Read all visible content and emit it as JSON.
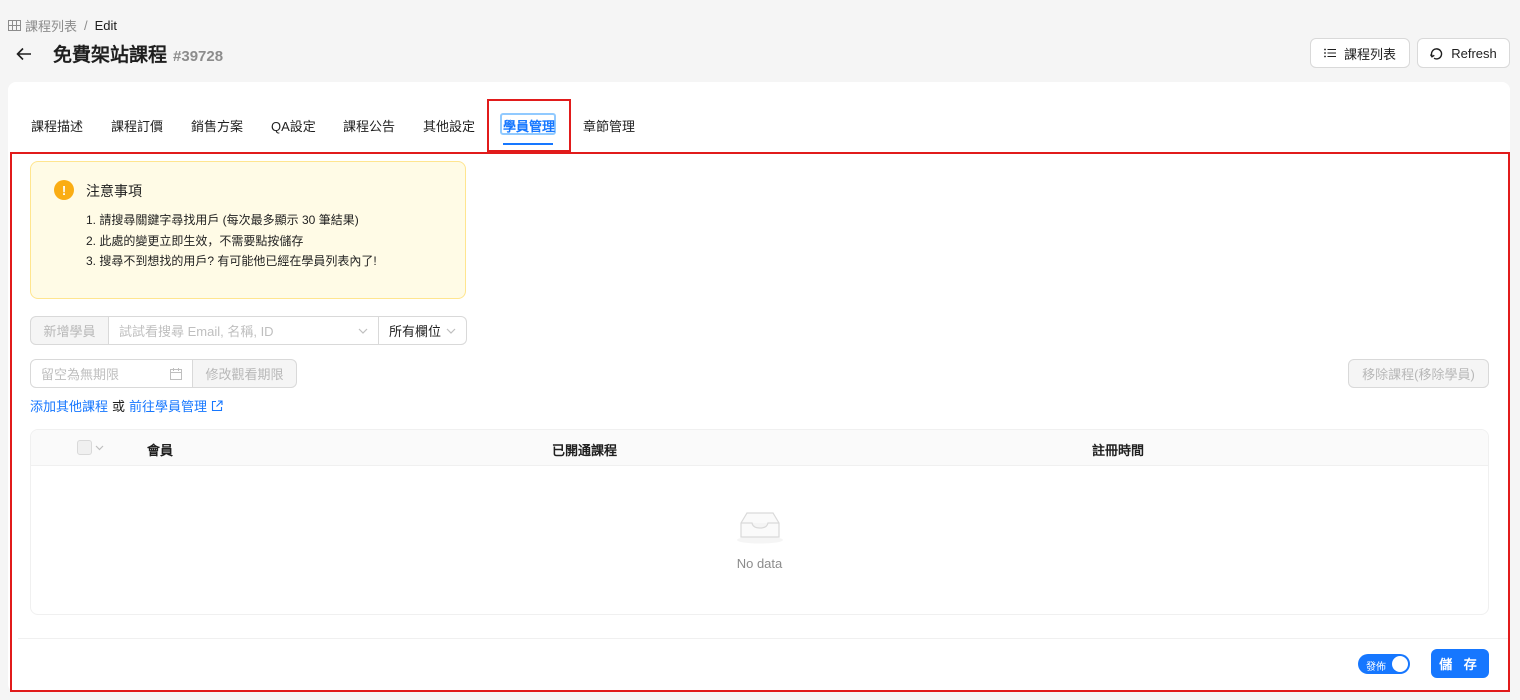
{
  "breadcrumb": {
    "parent": "課程列表",
    "separator": "/",
    "current": "Edit"
  },
  "header": {
    "title": "免費架站課程",
    "course_id": "#39728"
  },
  "header_buttons": {
    "course_list": "課程列表",
    "refresh": "Refresh"
  },
  "tabs": [
    {
      "label": "課程描述"
    },
    {
      "label": "課程訂價"
    },
    {
      "label": "銷售方案"
    },
    {
      "label": "QA設定"
    },
    {
      "label": "課程公告"
    },
    {
      "label": "其他設定"
    },
    {
      "label": "學員管理",
      "active": true
    },
    {
      "label": "章節管理"
    }
  ],
  "notice": {
    "icon": "!",
    "title": "注意事項",
    "items": [
      "1. 請搜尋關鍵字尋找用戶 (每次最多顯示 30 筆結果)",
      "2. 此處的變更立即生效，不需要點按儲存",
      "3. 搜尋不到想找的用戶? 有可能他已經在學員列表內了!"
    ]
  },
  "add_student": {
    "button": "新增學員",
    "search_placeholder": "試試看搜尋 Email, 名稱, ID",
    "field_select": "所有欄位"
  },
  "expire": {
    "placeholder": "留空為無期限",
    "modify_button": "修改觀看期限",
    "remove_button": "移除課程(移除學員)"
  },
  "links": {
    "add_other": "添加其他課程",
    "or": "或",
    "goto_students": "前往學員管理"
  },
  "table": {
    "columns": [
      "會員",
      "已開通課程",
      "註冊時間"
    ],
    "empty_text": "No data"
  },
  "footer": {
    "publish_label": "發佈",
    "save_label": "儲 存"
  },
  "colors": {
    "primary": "#1677ff",
    "highlight": "#e11b1b",
    "warning": "#faad14",
    "notice_bg": "#fffbe6"
  }
}
